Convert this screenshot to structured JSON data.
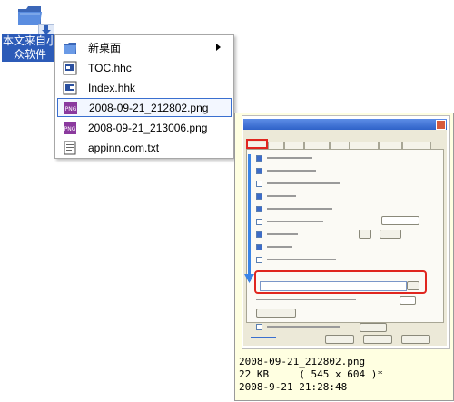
{
  "desktop": {
    "folder_label": "本文来自小众软件"
  },
  "menu": {
    "items": [
      {
        "label": "新桌面",
        "icon": "folder-icon",
        "has_submenu": true
      },
      {
        "label": "TOC.hhc",
        "icon": "hhc-file-icon"
      },
      {
        "label": "Index.hhk",
        "icon": "hhk-file-icon"
      },
      {
        "label": "2008-09-21_212802.png",
        "icon": "png-file-icon",
        "selected": true
      },
      {
        "label": "2008-09-21_213006.png",
        "icon": "png-file-icon"
      },
      {
        "label": "appinn.com.txt",
        "icon": "text-file-icon"
      }
    ]
  },
  "preview": {
    "filename": "2008-09-21_212802.png",
    "size_line": "22 KB     ( 545 x 604 )*",
    "date_line": "2008-9-21 21:28:48"
  },
  "colors": {
    "selection_border": "#3a6fcf",
    "highlight_red": "#e0261f",
    "arrow_blue": "#3a84e6",
    "tooltip_bg": "#ffffe1"
  }
}
